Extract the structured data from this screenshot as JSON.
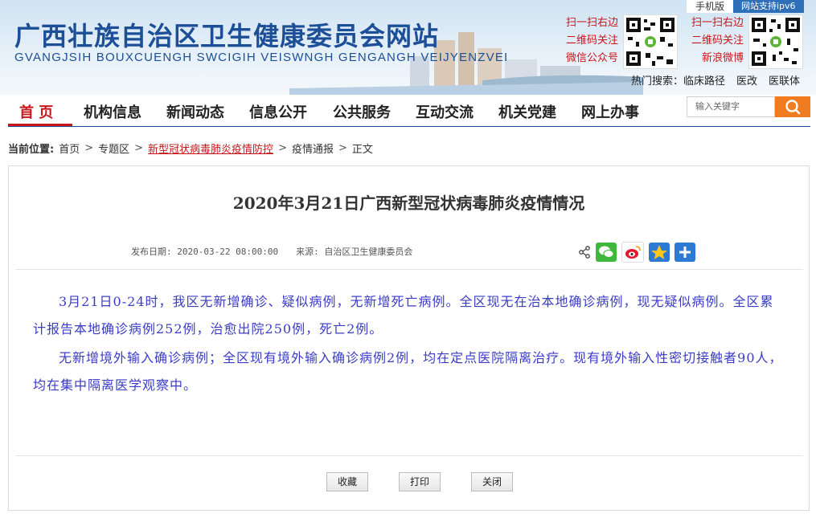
{
  "header": {
    "title": "广西壮族自治区卫生健康委员会网站",
    "subtitle": "GVANGJSIH BOUXCUENGH SWCIGIH VEISWNGH GENGANGH VEIJYENZVEI",
    "tabs": {
      "mobile": "手机版",
      "ipv6": "网站支持ipv6"
    },
    "qr_left": {
      "line1": "扫一扫右边",
      "line2": "二维码关注",
      "line3": "微信公众号"
    },
    "qr_right": {
      "line1": "扫一扫右边",
      "line2": "二维码关注",
      "line3": "新浪微博"
    },
    "hot_search": {
      "label": "热门搜索：",
      "items": [
        "临床路径",
        "医改",
        "医联体"
      ]
    }
  },
  "nav": {
    "items": [
      "首 页",
      "机构信息",
      "新闻动态",
      "信息公开",
      "公共服务",
      "互动交流",
      "机关党建",
      "网上办事"
    ],
    "search_placeholder": "输入关键字"
  },
  "breadcrumb": {
    "label": "当前位置:",
    "items": [
      "首页",
      "专题区",
      "新型冠状病毒肺炎疫情防控",
      "疫情通报",
      "正文"
    ]
  },
  "article": {
    "title": "2020年3月21日广西新型冠状病毒肺炎疫情情况",
    "date": "发布日期: 2020-03-22 08:00:00",
    "source": "来源: 自治区卫生健康委员会",
    "paragraphs": [
      "3月21日0-24时，我区无新增确诊、疑似病例，无新增死亡病例。全区现无在治本地确诊病例，现无疑似病例。全区累计报告本地确诊病例252例，治愈出院250例，死亡2例。",
      "无新增境外输入确诊病例；全区现有境外输入确诊病例2例，均在定点医院隔离治疗。现有境外输入性密切接触者90人，均在集中隔离医学观察中。"
    ]
  },
  "actions": {
    "collect": "收藏",
    "print": "打印",
    "close": "关闭"
  },
  "colors": {
    "brand_blue": "#1c4f97",
    "accent_red": "#c8161d",
    "search_orange": "#f07c1f",
    "body_text": "#3a3cc4"
  },
  "icons": [
    "share-icon",
    "wechat-icon",
    "weibo-icon",
    "qzone-icon",
    "more-share-icon",
    "search-icon",
    "qr-code-icon"
  ]
}
